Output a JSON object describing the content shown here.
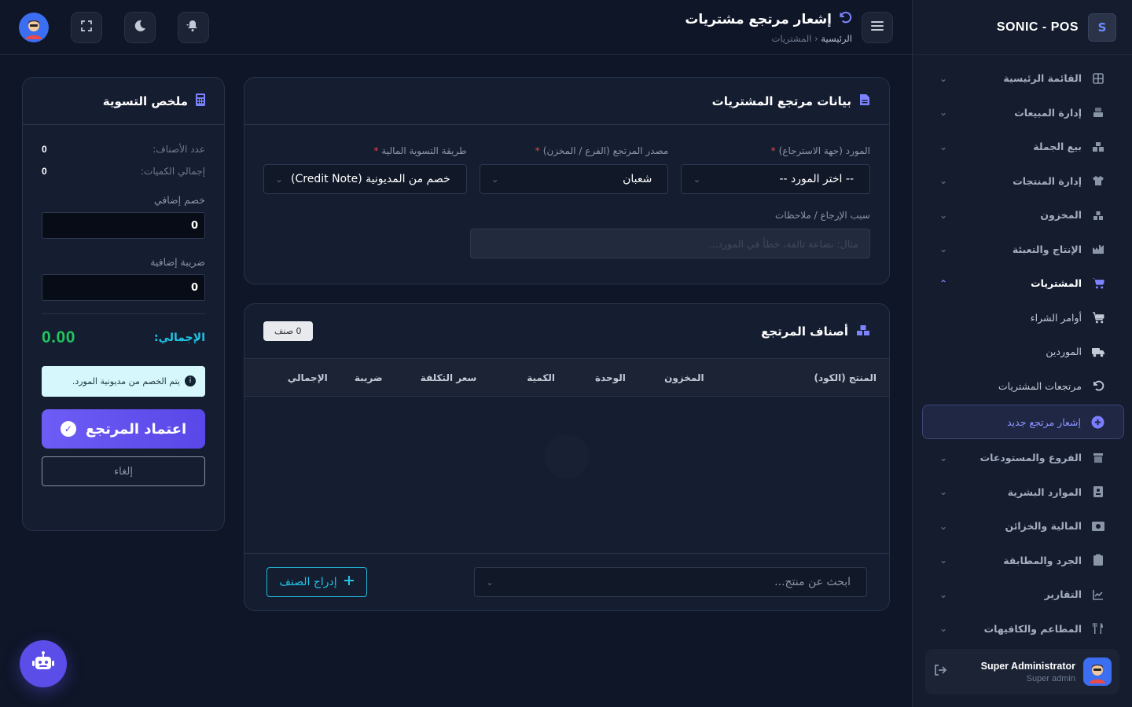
{
  "brand": {
    "name": "SONIC - POS"
  },
  "sidebar": {
    "items": [
      {
        "label": "القائمة الرئيسية",
        "icon": "grid-icon"
      },
      {
        "label": "إدارة المبيعات",
        "icon": "cash-register-icon"
      },
      {
        "label": "بيع الجملة",
        "icon": "boxes-icon"
      },
      {
        "label": "إدارة المنتجات",
        "icon": "shirt-icon"
      },
      {
        "label": "المخزون",
        "icon": "warehouse-icon"
      },
      {
        "label": "الإنتاج والتعبئة",
        "icon": "factory-icon"
      },
      {
        "label": "المشتريات",
        "icon": "cart-icon"
      }
    ],
    "sub_items": [
      {
        "label": "أوامر الشراء",
        "icon": "cart-icon"
      },
      {
        "label": "الموردين",
        "icon": "truck-icon"
      },
      {
        "label": "مرتجعات المشتريات",
        "icon": "undo-icon"
      },
      {
        "label": "إشعار مرتجع جديد",
        "icon": "plus-circle-icon"
      }
    ],
    "items_after": [
      {
        "label": "الفروع والمستودعات",
        "icon": "store-icon"
      },
      {
        "label": "الموارد البشرية",
        "icon": "id-badge-icon"
      },
      {
        "label": "المالية والخزائن",
        "icon": "money-icon"
      },
      {
        "label": "الجرد والمطابقة",
        "icon": "clipboard-icon"
      },
      {
        "label": "التقارير",
        "icon": "chart-line-icon"
      },
      {
        "label": "المطاعم والكافيهات",
        "icon": "utensils-icon"
      }
    ]
  },
  "user": {
    "name": "Super Administrator",
    "role": "Super admin"
  },
  "header": {
    "title": "إشعار مرتجع مشتريات",
    "breadcrumb_home": "الرئيسية",
    "breadcrumb_sep": "‹",
    "breadcrumb_current": "المشتريات"
  },
  "return_form": {
    "title": "بيانات مرتجع المشتريات",
    "supplier_label": "المورد (جهة الاسترجاع)",
    "supplier_value": "-- اختر المورد --",
    "source_label": "مصدر المرتجع (الفرع / المخزن)",
    "source_value": "شعبان",
    "settlement_label": "طريقة التسوية المالية",
    "settlement_value": "خصم من المديونية (Credit Note)",
    "reason_label": "سبب الإرجاع / ملاحظات",
    "reason_placeholder": "مثال: بضاعة تالفة، خطأ في المورد..."
  },
  "items": {
    "title": "أصناف المرتجع",
    "count_badge": "0 صنف",
    "columns": [
      "المنتج (الكود)",
      "المخزون",
      "الوحدة",
      "الكمية",
      "سعر التكلفة",
      "ضريبة",
      "الإجمالي"
    ],
    "search_placeholder": "ابحث عن منتج...",
    "insert_label": "إدراج الصنف"
  },
  "summary": {
    "title": "ملخص التسوية",
    "items_count_label": "عدد الأصناف:",
    "items_count_value": "0",
    "qty_total_label": "إجمالي الكميات:",
    "qty_total_value": "0",
    "extra_discount_label": "خصم إضافي",
    "extra_discount_value": "0",
    "extra_tax_label": "ضريبة إضافية",
    "extra_tax_value": "0",
    "total_label": "الإجمالي:",
    "total_value": "0.00",
    "note": "يتم الخصم من مديونية المورد.",
    "approve_label": "اعتماد المرتجع",
    "cancel_label": "إلغاء"
  },
  "colors": {
    "accent": "#7c83ff",
    "cyan": "#22c4e6",
    "green": "#22c55e",
    "bg": "#0f1628"
  }
}
